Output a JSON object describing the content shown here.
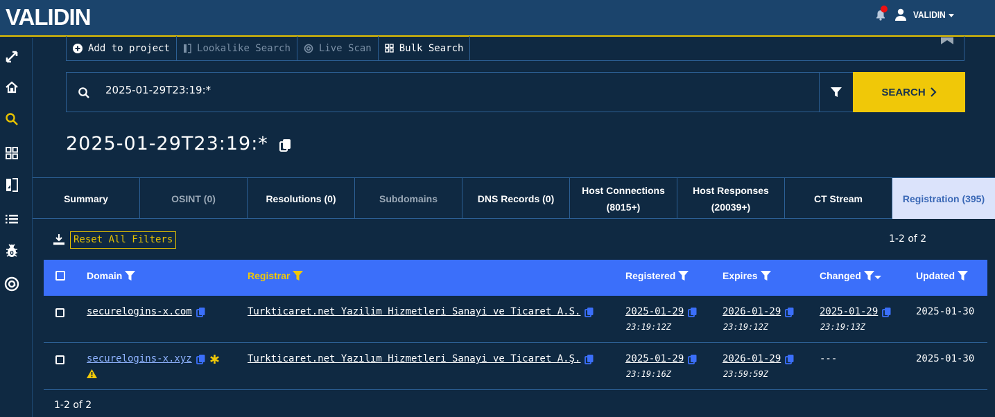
{
  "header": {
    "logo": "VALIDIN",
    "user_name": "VALIDIN",
    "notification_badge": true,
    "colors": {
      "topbar": "#1b446c",
      "accent": "#e6c200",
      "background": "#0f2942"
    }
  },
  "sidebar": {
    "items": [
      {
        "icon": "expand-icon",
        "label": "Expand"
      },
      {
        "icon": "home-icon",
        "label": "Home"
      },
      {
        "icon": "search-icon",
        "label": "Search",
        "active": true
      },
      {
        "icon": "grid-icon",
        "label": "Dashboard"
      },
      {
        "icon": "lookalike-icon",
        "label": "Lookalike"
      },
      {
        "icon": "list-icon",
        "label": "List"
      },
      {
        "icon": "bug-icon",
        "label": "Bug"
      },
      {
        "icon": "at-icon",
        "label": "Live Scan"
      }
    ]
  },
  "toolbar": {
    "add_to_project": "Add to project",
    "lookalike_search": "Lookalike Search",
    "live_scan": "Live Scan",
    "bulk_search": "Bulk Search"
  },
  "search": {
    "value": "2025-01-29T23:19:*",
    "button_label": "SEARCH"
  },
  "query_title": "2025-01-29T23:19:*",
  "tabs": [
    {
      "label": "Summary",
      "state": "normal"
    },
    {
      "label": "OSINT (0)",
      "state": "muted"
    },
    {
      "label": "Resolutions (0)",
      "state": "normal"
    },
    {
      "label": "Subdomains",
      "state": "muted"
    },
    {
      "label": "DNS Records (0)",
      "state": "normal"
    },
    {
      "label": "Host Connections",
      "label2": "(8015+)",
      "state": "normal"
    },
    {
      "label": "Host Responses",
      "label2": "(20039+)",
      "state": "normal"
    },
    {
      "label": "CT Stream",
      "state": "normal"
    },
    {
      "label": "Registration (395)",
      "state": "active"
    }
  ],
  "results": {
    "reset_filters": "Reset All Filters",
    "count_top": "1-2 of 2",
    "count_bottom": "1-2 of 2",
    "columns": {
      "domain": "Domain",
      "registrar": "Registrar",
      "registered": "Registered",
      "expires": "Expires",
      "changed": "Changed",
      "updated": "Updated"
    },
    "rows": [
      {
        "domain": "securelogins-x.com",
        "registrar": "Turkticaret.net Yazilim Hizmetleri Sanayi ve Ticaret A.S.",
        "registered_date": "2025-01-29",
        "registered_time": "23:19:12Z",
        "expires_date": "2026-01-29",
        "expires_time": "23:19:12Z",
        "changed_date": "2025-01-29",
        "changed_time": "23:19:13Z",
        "updated": "2025-01-30"
      },
      {
        "domain": "securelogins-x.xyz",
        "registrar": "Turkticaret.net Yazılım Hizmetleri Sanayi ve Ticaret A.Ş.",
        "registered_date": "2025-01-29",
        "registered_time": "23:19:16Z",
        "expires_date": "2026-01-29",
        "expires_time": "23:59:59Z",
        "changed_date": "---",
        "changed_time": "",
        "updated": "2025-01-30",
        "flags": [
          "new-star",
          "warning"
        ]
      }
    ]
  }
}
